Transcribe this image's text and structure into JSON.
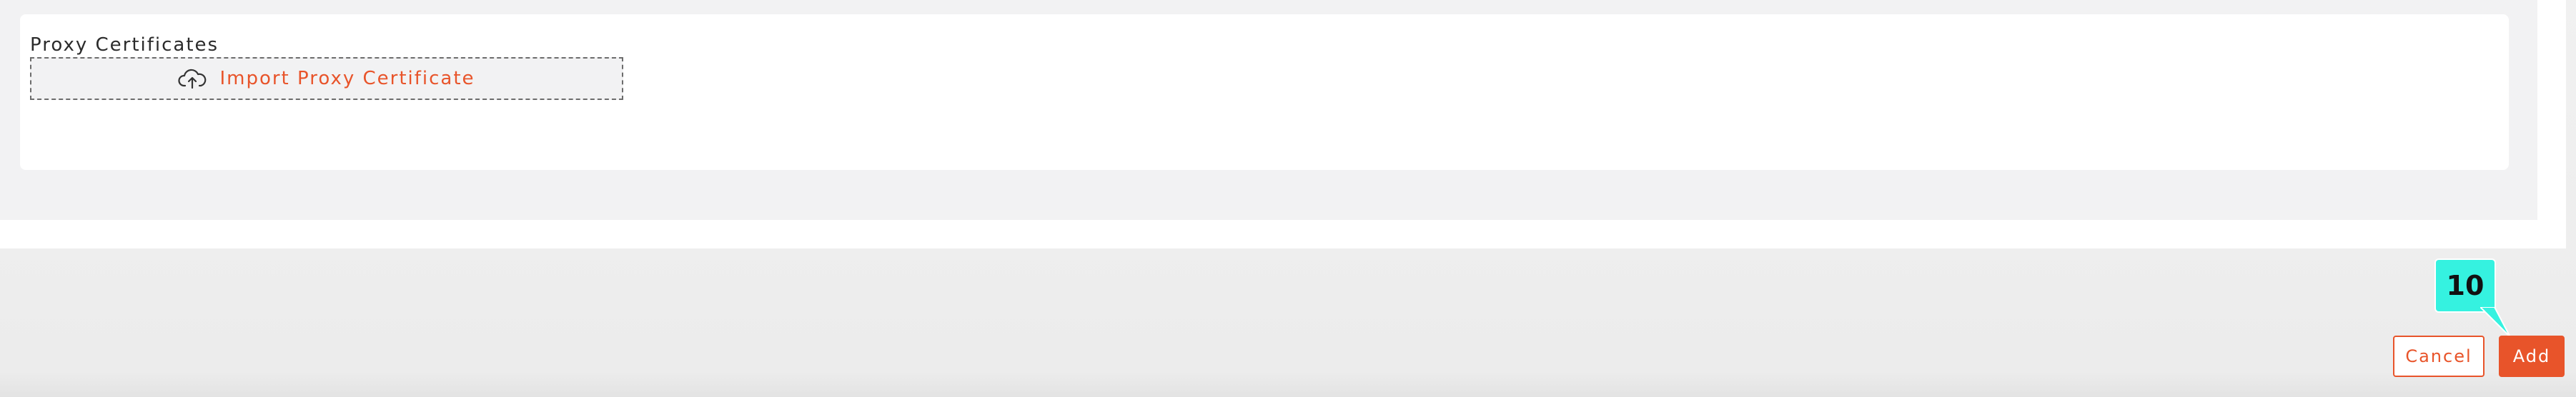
{
  "proxy_section": {
    "label": "Proxy Certificates",
    "import_button": {
      "label": "Import Proxy Certificate",
      "icon": "cloud-upload-icon"
    }
  },
  "footer": {
    "cancel_label": "Cancel",
    "add_label": "Add"
  },
  "annotation": {
    "number": "10",
    "color": "#35f2e0"
  },
  "colors": {
    "accent": "#e8542a",
    "panel_bg": "#f2f2f3",
    "card_bg": "#ffffff"
  }
}
